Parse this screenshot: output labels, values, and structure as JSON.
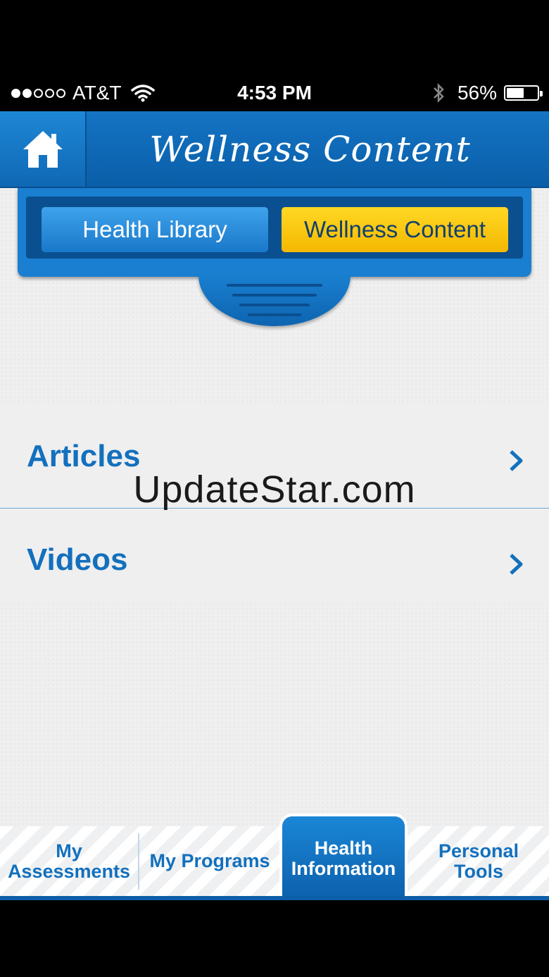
{
  "status_bar": {
    "carrier": "AT&T",
    "time": "4:53 PM",
    "battery": "56%",
    "battery_level": 0.56,
    "signal_bars_filled": 2,
    "signal_bars_total": 5
  },
  "header": {
    "title": "Wellness Content",
    "home_icon": "home-icon"
  },
  "segments": {
    "health_library": "Health Library",
    "wellness_content": "Wellness Content",
    "selected": "wellness_content"
  },
  "list": {
    "items": [
      {
        "label": "Articles"
      },
      {
        "label": "Videos"
      }
    ]
  },
  "watermark": "UpdateStar.com",
  "tabs": [
    {
      "line1": "My",
      "line2": "Assessments"
    },
    {
      "line1": "My Programs",
      "line2": ""
    },
    {
      "line1": "Health",
      "line2": "Information"
    },
    {
      "line1": "Personal",
      "line2": "Tools"
    }
  ],
  "colors": {
    "primary_blue": "#1370bd",
    "selected_yellow": "#f4b800",
    "header_blue": "#0a5ea8"
  }
}
